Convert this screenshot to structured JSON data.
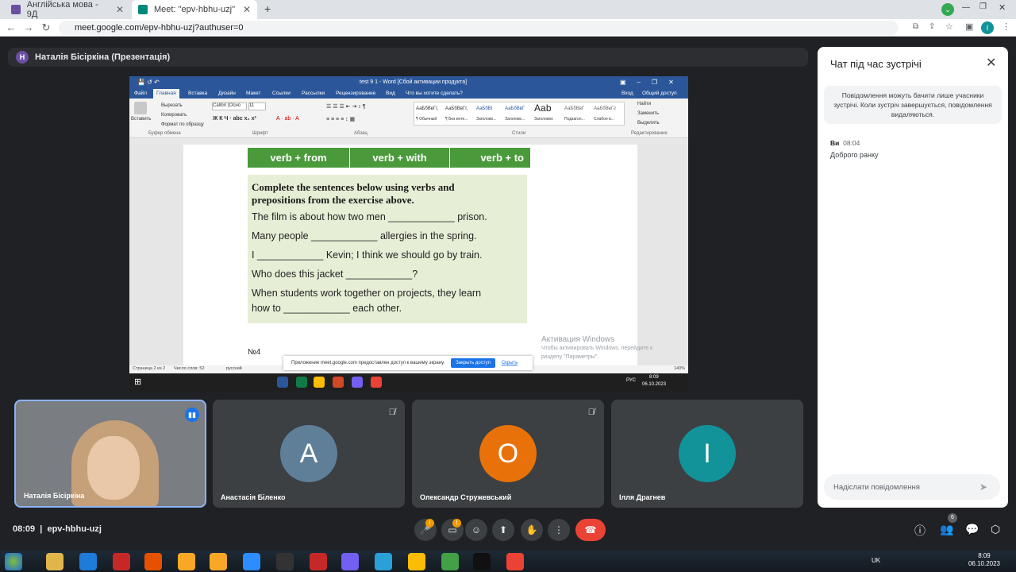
{
  "browser": {
    "tabs": [
      {
        "label": "Англійська мова - 9Д",
        "active": false
      },
      {
        "label": "Meet: \"epv-hbhu-uzj\"",
        "active": true
      }
    ],
    "url": "meet.google.com/epv-hbhu-uzj?authuser=0",
    "profile_letter": "I"
  },
  "meet": {
    "presenter_initial": "Н",
    "presenter_label": "Наталія Бісіркіна (Презентація)",
    "time": "08:09",
    "meeting_code": "epv-hbhu-uzj",
    "people_count": "6"
  },
  "shared_screen": {
    "word_title": "test 9 1 - Word [Сбой активации продукта]",
    "ribbon_tabs": [
      "Файл",
      "Главная",
      "Вставка",
      "Дизайн",
      "Макет",
      "Ссылки",
      "Рассылки",
      "Рецензирование",
      "Вид"
    ],
    "tell_me": "Что вы хотите сделать?",
    "sign_in": "Вход",
    "share": "Общий доступ",
    "clipboard_items": [
      "Вставить",
      "Вырезать",
      "Копировать",
      "Формат по образцу"
    ],
    "font_name": "Calibri (Осно",
    "font_size": "11",
    "styles": [
      "АаБбВвГг,",
      "АаБбВвГг,",
      "АаБбВі",
      "АаБбВвГ",
      "Ааb",
      "АаБбВвГ",
      "АаБбВвГг"
    ],
    "style_names": [
      "¶ Обычный",
      "¶ Без инте...",
      "Заголово...",
      "Заголово...",
      "Заголовок",
      "Подзагол...",
      "Слабое в..."
    ],
    "edit_items": [
      "Найти",
      "Заменить",
      "Выделить"
    ],
    "group_labels": [
      "Буфер обмена",
      "Шрифт",
      "Абзац",
      "Стили",
      "Редактирование"
    ],
    "green_buttons": [
      "verb + from",
      "verb + with",
      "verb + to"
    ],
    "exercise_heading_1": "Complete the sentences below using verbs and",
    "exercise_heading_2": "prepositions from the exercise above.",
    "sentences": [
      "The film is about how two men ____________ prison.",
      "Many people ____________ allergies in the spring.",
      "I ____________ Kevin; I think we should go by train.",
      "Who does this jacket ____________?",
      "When students work together on projects, they learn",
      "how to ____________ each other."
    ],
    "number_label": "№4",
    "share_notice": "Приложение meet.google.com предоставлен доступ к вашему экрану.",
    "stop_sharing": "Закрыть доступ",
    "hide": "Скрыть",
    "activation_title": "Активация Windows",
    "activation_line1": "Чтобы активировать Windows, перейдите к",
    "activation_line2": "разделу \"Параметры\".",
    "status_page": "Страница 2 из 2",
    "status_words": "Число слов: 52",
    "status_lang": "русский",
    "zoom": "140%",
    "win_lang": "РУС",
    "win_time": "8:09",
    "win_date": "06.10.2023"
  },
  "chat": {
    "title": "Чат під час зустрічі",
    "notice": "Повідомлення можуть бачити лише учасники зустрічі. Коли зустріч завершується, повідомлення видаляються.",
    "messages": [
      {
        "sender": "Ви",
        "time": "08:04",
        "text": "Доброго ранку"
      }
    ],
    "input_placeholder": "Надіслати повідомлення"
  },
  "participants": [
    {
      "name": "Наталія Бісіркіна",
      "initial": "",
      "color": "",
      "muted": false,
      "video": true
    },
    {
      "name": "Анастасія Біленко",
      "initial": "A",
      "color": "#5f7f99",
      "muted": true
    },
    {
      "name": "Олександр Стружевський",
      "initial": "O",
      "color": "#e8710a",
      "muted": true
    },
    {
      "name": "Ілля Драгнев",
      "initial": "I",
      "color": "#12939a",
      "muted": false
    }
  ],
  "os": {
    "lang": "UK",
    "time": "8:09",
    "date": "06.10.2023"
  }
}
